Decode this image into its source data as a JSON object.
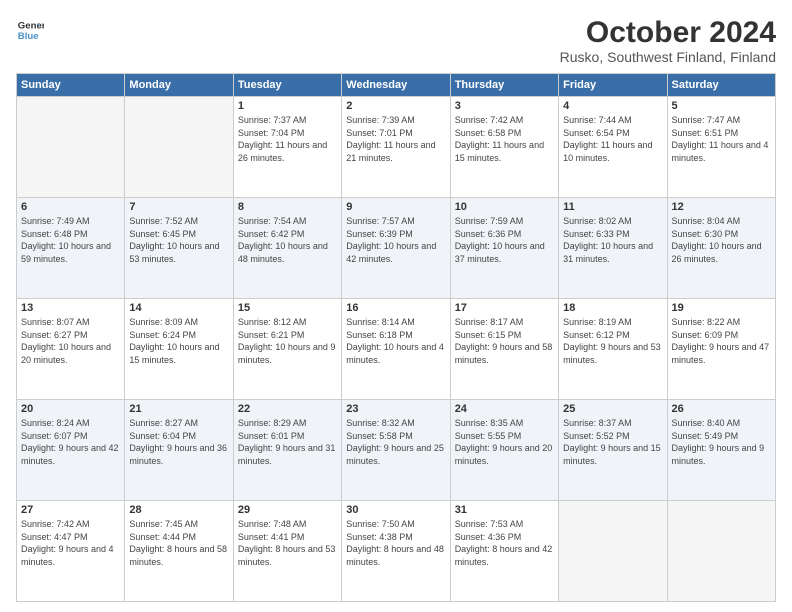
{
  "logo": {
    "line1": "General",
    "line2": "Blue"
  },
  "title": "October 2024",
  "subtitle": "Rusko, Southwest Finland, Finland",
  "days_of_week": [
    "Sunday",
    "Monday",
    "Tuesday",
    "Wednesday",
    "Thursday",
    "Friday",
    "Saturday"
  ],
  "weeks": [
    [
      {
        "day": "",
        "info": ""
      },
      {
        "day": "",
        "info": ""
      },
      {
        "day": "1",
        "info": "Sunrise: 7:37 AM\nSunset: 7:04 PM\nDaylight: 11 hours and 26 minutes."
      },
      {
        "day": "2",
        "info": "Sunrise: 7:39 AM\nSunset: 7:01 PM\nDaylight: 11 hours and 21 minutes."
      },
      {
        "day": "3",
        "info": "Sunrise: 7:42 AM\nSunset: 6:58 PM\nDaylight: 11 hours and 15 minutes."
      },
      {
        "day": "4",
        "info": "Sunrise: 7:44 AM\nSunset: 6:54 PM\nDaylight: 11 hours and 10 minutes."
      },
      {
        "day": "5",
        "info": "Sunrise: 7:47 AM\nSunset: 6:51 PM\nDaylight: 11 hours and 4 minutes."
      }
    ],
    [
      {
        "day": "6",
        "info": "Sunrise: 7:49 AM\nSunset: 6:48 PM\nDaylight: 10 hours and 59 minutes."
      },
      {
        "day": "7",
        "info": "Sunrise: 7:52 AM\nSunset: 6:45 PM\nDaylight: 10 hours and 53 minutes."
      },
      {
        "day": "8",
        "info": "Sunrise: 7:54 AM\nSunset: 6:42 PM\nDaylight: 10 hours and 48 minutes."
      },
      {
        "day": "9",
        "info": "Sunrise: 7:57 AM\nSunset: 6:39 PM\nDaylight: 10 hours and 42 minutes."
      },
      {
        "day": "10",
        "info": "Sunrise: 7:59 AM\nSunset: 6:36 PM\nDaylight: 10 hours and 37 minutes."
      },
      {
        "day": "11",
        "info": "Sunrise: 8:02 AM\nSunset: 6:33 PM\nDaylight: 10 hours and 31 minutes."
      },
      {
        "day": "12",
        "info": "Sunrise: 8:04 AM\nSunset: 6:30 PM\nDaylight: 10 hours and 26 minutes."
      }
    ],
    [
      {
        "day": "13",
        "info": "Sunrise: 8:07 AM\nSunset: 6:27 PM\nDaylight: 10 hours and 20 minutes."
      },
      {
        "day": "14",
        "info": "Sunrise: 8:09 AM\nSunset: 6:24 PM\nDaylight: 10 hours and 15 minutes."
      },
      {
        "day": "15",
        "info": "Sunrise: 8:12 AM\nSunset: 6:21 PM\nDaylight: 10 hours and 9 minutes."
      },
      {
        "day": "16",
        "info": "Sunrise: 8:14 AM\nSunset: 6:18 PM\nDaylight: 10 hours and 4 minutes."
      },
      {
        "day": "17",
        "info": "Sunrise: 8:17 AM\nSunset: 6:15 PM\nDaylight: 9 hours and 58 minutes."
      },
      {
        "day": "18",
        "info": "Sunrise: 8:19 AM\nSunset: 6:12 PM\nDaylight: 9 hours and 53 minutes."
      },
      {
        "day": "19",
        "info": "Sunrise: 8:22 AM\nSunset: 6:09 PM\nDaylight: 9 hours and 47 minutes."
      }
    ],
    [
      {
        "day": "20",
        "info": "Sunrise: 8:24 AM\nSunset: 6:07 PM\nDaylight: 9 hours and 42 minutes."
      },
      {
        "day": "21",
        "info": "Sunrise: 8:27 AM\nSunset: 6:04 PM\nDaylight: 9 hours and 36 minutes."
      },
      {
        "day": "22",
        "info": "Sunrise: 8:29 AM\nSunset: 6:01 PM\nDaylight: 9 hours and 31 minutes."
      },
      {
        "day": "23",
        "info": "Sunrise: 8:32 AM\nSunset: 5:58 PM\nDaylight: 9 hours and 25 minutes."
      },
      {
        "day": "24",
        "info": "Sunrise: 8:35 AM\nSunset: 5:55 PM\nDaylight: 9 hours and 20 minutes."
      },
      {
        "day": "25",
        "info": "Sunrise: 8:37 AM\nSunset: 5:52 PM\nDaylight: 9 hours and 15 minutes."
      },
      {
        "day": "26",
        "info": "Sunrise: 8:40 AM\nSunset: 5:49 PM\nDaylight: 9 hours and 9 minutes."
      }
    ],
    [
      {
        "day": "27",
        "info": "Sunrise: 7:42 AM\nSunset: 4:47 PM\nDaylight: 9 hours and 4 minutes."
      },
      {
        "day": "28",
        "info": "Sunrise: 7:45 AM\nSunset: 4:44 PM\nDaylight: 8 hours and 58 minutes."
      },
      {
        "day": "29",
        "info": "Sunrise: 7:48 AM\nSunset: 4:41 PM\nDaylight: 8 hours and 53 minutes."
      },
      {
        "day": "30",
        "info": "Sunrise: 7:50 AM\nSunset: 4:38 PM\nDaylight: 8 hours and 48 minutes."
      },
      {
        "day": "31",
        "info": "Sunrise: 7:53 AM\nSunset: 4:36 PM\nDaylight: 8 hours and 42 minutes."
      },
      {
        "day": "",
        "info": ""
      },
      {
        "day": "",
        "info": ""
      }
    ]
  ]
}
